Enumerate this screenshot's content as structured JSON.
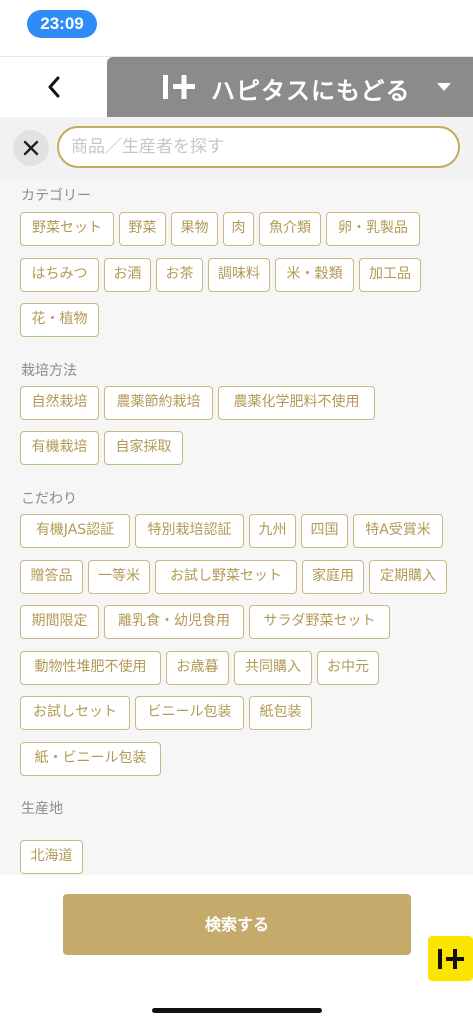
{
  "status_bar": {
    "time": "23:09"
  },
  "header": {
    "hapitas_label": "ハピタスにもどる"
  },
  "search": {
    "placeholder": "商品／生産者を探す",
    "value": ""
  },
  "sections": {
    "category": {
      "title": "カテゴリー",
      "tags": [
        "野菜セット",
        "野菜",
        "果物",
        "肉",
        "魚介類",
        "卵・乳製品",
        "はちみつ",
        "お酒",
        "お茶",
        "調味料",
        "米・穀類",
        "加工品",
        "花・植物"
      ]
    },
    "cultivation": {
      "title": "栽培方法",
      "tags": [
        "自然栽培",
        "農薬節約栽培",
        "農薬化学肥料不使用",
        "有機栽培",
        "自家採取"
      ]
    },
    "kodawari": {
      "title": "こだわり",
      "tags": [
        "有機JAS認証",
        "特別栽培認証",
        "九州",
        "四国",
        "特A受賞米",
        "贈答品",
        "一等米",
        "お試し野菜セット",
        "家庭用",
        "定期購入",
        "期間限定",
        "離乳食・幼児食用",
        "サラダ野菜セット",
        "動物性堆肥不使用",
        "お歳暮",
        "共同購入",
        "お中元",
        "お試しセット",
        "ビニール包装",
        "紙包装",
        "紙・ビニール包装"
      ]
    },
    "origin": {
      "title": "生産地",
      "tags": [
        "北海道"
      ]
    }
  },
  "actions": {
    "search_button": "検索する"
  },
  "colors": {
    "accent_gold": "#c4ab6c",
    "tag_text": "#b29a55",
    "status_pill": "#2f8cf6",
    "hapitas_yellow": "#fbe500"
  }
}
